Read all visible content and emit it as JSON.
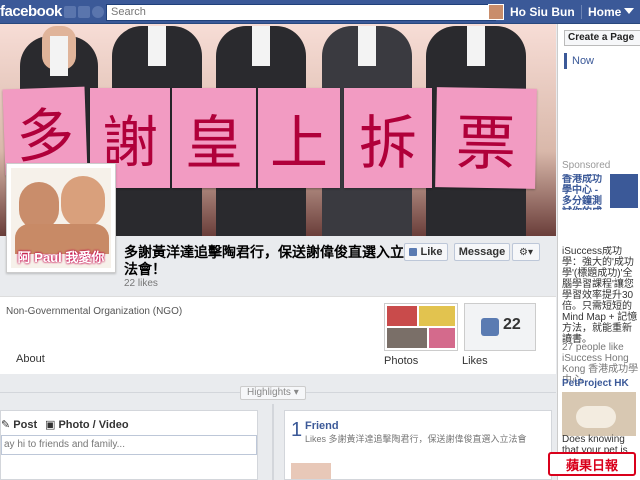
{
  "topbar": {
    "logo": "facebook",
    "search_placeholder": "Search",
    "user_name": "Ho Siu Bun",
    "home_label": "Home"
  },
  "cover": {
    "signs": [
      "多",
      "謝",
      "皇",
      "上",
      "拆",
      "票"
    ]
  },
  "profile": {
    "caption": "阿 Paul 我愛你"
  },
  "page": {
    "title": "多謝黃洋達追擊陶君行，保送謝偉俊直選入立法會！",
    "likes": "22 likes",
    "like_button": "Like",
    "message_button": "Message",
    "settings_icon": "gear-icon",
    "category": "Non-Governmental Organization (NGO)",
    "about_label": "About",
    "photos_label": "Photos",
    "likes_label": "Likes",
    "likes_number": "22"
  },
  "timeline": {
    "highlights_label": "Highlights",
    "composer": {
      "post_tab": "Post",
      "photo_tab": "Photo / Video",
      "placeholder": "ay hi to friends and family..."
    },
    "friend_box": {
      "number": "1",
      "title": "Friend",
      "text": "Likes 多謝黃洋達追擊陶君行，保送謝偉俊直選入立法會"
    }
  },
  "sidebar": {
    "create_page": "Create a Page",
    "now": "Now",
    "sponsored": "Sponsored",
    "ad1_title": "香港成功學中心 - 多分鐘測試你的成功指數",
    "ad2_text": "iSuccess成功學：強大的'成功學'(標題成功)'全腦學習課程'讓您學習效率提升30倍。只需短短的Mind Map + 記憶方法，就能重新讀書。",
    "ad2_likes": "27 people like iSuccess Hong Kong 香港成功學中心.",
    "ad3_title": "PetProject HK",
    "ad3_text": "Does knowing that your pet is",
    "watermark": "蘋果日報"
  },
  "colors": {
    "brand": "#3b5998",
    "sign_pink": "#f29bc2",
    "watermark_red": "#d9001b"
  }
}
